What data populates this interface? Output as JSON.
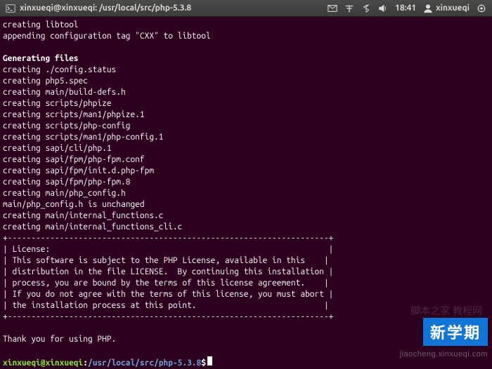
{
  "menubar": {
    "title_icon": "terminal-icon",
    "title": "xinxueqi@xinxueqi: /usr/local/src/php-5.3.8",
    "clock": "18:41",
    "username": "xinxueqi"
  },
  "terminal": {
    "pre_lines": [
      "creating libtool",
      "appending configuration tag \"CXX\" to libtool",
      ""
    ],
    "heading": "Generating files",
    "gen_lines": [
      "creating ./config.status",
      "creating php5.spec",
      "creating main/build-defs.h",
      "creating scripts/phpize",
      "creating scripts/man1/phpize.1",
      "creating scripts/php-config",
      "creating scripts/man1/php-config.1",
      "creating sapi/cli/php.1",
      "creating sapi/fpm/php-fpm.conf",
      "creating sapi/fpm/init.d.php-fpm",
      "creating sapi/fpm/php-fpm.8",
      "creating main/php_config.h",
      "main/php_config.h is unchanged",
      "creating main/internal_functions.c",
      "creating main/internal_functions_cli.c"
    ],
    "license_border_top": "+--------------------------------------------------------------------+",
    "license_lines": [
      "| License:                                                           |",
      "| This software is subject to the PHP License, available in this    |",
      "| distribution in the file LICENSE.  By continuing this installation |",
      "| process, you are bound by the terms of this license agreement.    |",
      "| If you do not agree with the terms of this license, you must abort |",
      "| the installation process at this point.                           |"
    ],
    "license_border_bottom": "+--------------------------------------------------------------------+",
    "thanks": "Thank you for using PHP.",
    "prompt": {
      "user_host": "xinxueqi@xinxueqi",
      "colon": ":",
      "path": "/usr/local/src/php-5.3.8",
      "dollar": "$"
    }
  },
  "overlays": {
    "badge_text": "新学期",
    "watermark1": "jiaocheng.xinxueqi.com",
    "watermark2": "脚本之家 教程网"
  }
}
